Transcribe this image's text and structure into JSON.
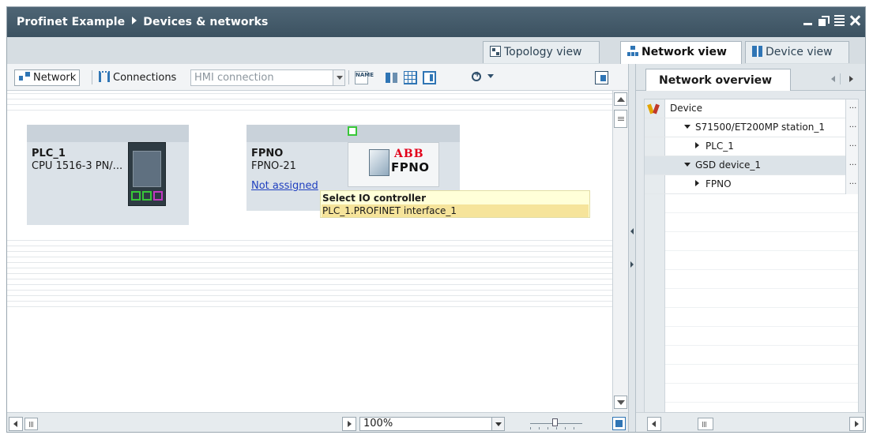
{
  "window": {
    "title_project": "Profinet Example",
    "title_section": "Devices & networks"
  },
  "view_tabs": {
    "topology": "Topology view",
    "network": "Network view",
    "device": "Device view"
  },
  "toolbar": {
    "network_label": "Network",
    "connections_label": "Connections",
    "connection_type_value": "HMI connection",
    "name_icon_text": "NAME"
  },
  "devices": {
    "plc": {
      "name": "PLC_1",
      "type": "CPU 1516-3 PN/..."
    },
    "fpno": {
      "name": "FPNO",
      "type": "FPNO-21",
      "link": "Not assigned",
      "logo_text": "ABB",
      "image_text": "FPNO"
    }
  },
  "tooltip": {
    "title": "Select IO controller",
    "option": "PLC_1.PROFINET interface_1"
  },
  "statusbar": {
    "zoom_value": "100%"
  },
  "overview": {
    "tab_label": "Network overview",
    "column_header": "Device",
    "rows": [
      {
        "label": "S71500/ET200MP station_1",
        "level": 1,
        "expanded": true
      },
      {
        "label": "PLC_1",
        "level": 2,
        "expanded": false
      },
      {
        "label": "GSD device_1",
        "level": 1,
        "expanded": true
      },
      {
        "label": "FPNO",
        "level": 2,
        "expanded": false
      }
    ],
    "ellipsis": "..."
  },
  "colors": {
    "title_bar": "#46606f",
    "accent_blue": "#2f75b5",
    "port_green": "#38c738",
    "port_magenta": "#c238c2",
    "link_blue": "#1f3fbf",
    "tooltip_bg": "#ffffd8",
    "tooltip_selected": "#f6e49b",
    "abb_red": "#e2001a"
  },
  "icons": {
    "window_controls": [
      "minimize-icon",
      "float-icon",
      "maximize-icon",
      "close-icon"
    ],
    "toolbar": [
      "network-icon",
      "connections-icon",
      "name-icon",
      "device-pair-icon",
      "grid-icon",
      "panel-icon",
      "zoom-icon",
      "show-overview-icon"
    ]
  }
}
